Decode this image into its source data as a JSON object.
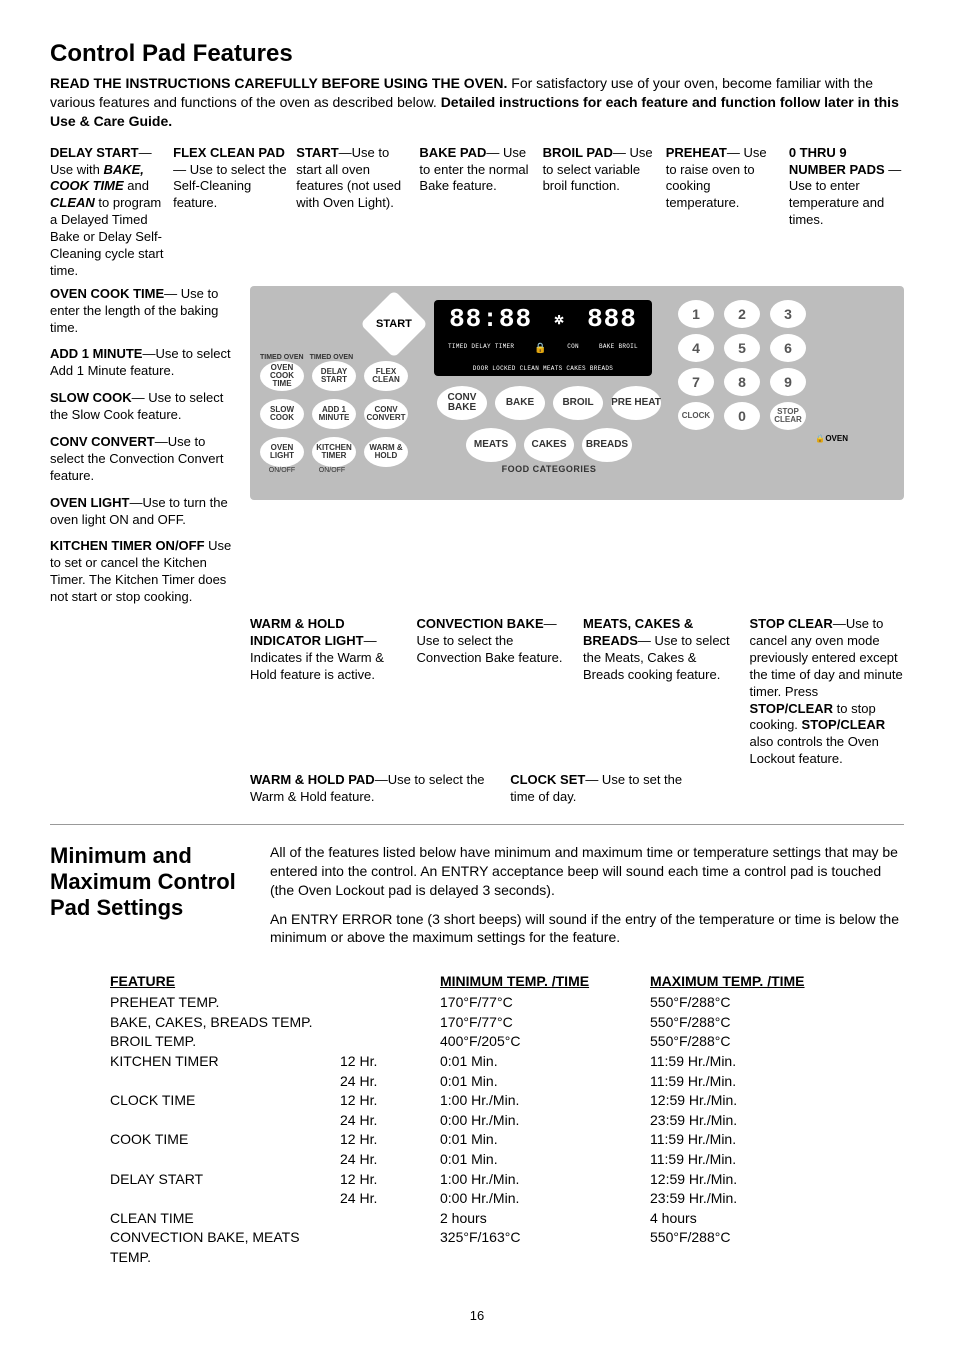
{
  "title": "Control Pad Features",
  "intro": {
    "bold1": "READ THE INSTRUCTIONS CAREFULLY BEFORE USING THE OVEN.",
    "mid": " For satisfactory use of your oven, become familiar with the various features and functions of the oven as described below. ",
    "bold2": "Detailed instructions for each feature and function follow later in this Use & Care Guide."
  },
  "topCallouts": [
    {
      "h": "DELAY START",
      "t": "— Use with BAKE, COOK TIME and CLEAN to program a Delayed Timed Bake or Delay Self-Cleaning cycle start time.",
      "bold2": "BAKE, COOK TIME",
      "bold3": "CLEAN"
    },
    {
      "h": "FLEX CLEAN PAD",
      "t": "— Use to select the Self-Cleaning feature."
    },
    {
      "h": "START",
      "t": "—Use to start all oven features (not used with Oven Light)."
    },
    {
      "h": "BAKE PAD",
      "t": "— Use to enter the normal Bake feature."
    },
    {
      "h": "BROIL PAD",
      "t": "— Use to select variable broil function."
    },
    {
      "h": "PREHEAT",
      "t": "— Use to raise oven to cooking temperature."
    },
    {
      "h": "0 THRU 9 NUMBER PADS",
      "t": " — Use to enter temperature and times."
    }
  ],
  "leftCallouts": [
    {
      "h": "OVEN COOK TIME",
      "t": "— Use to enter the length of the baking time."
    },
    {
      "h": "ADD 1 MINUTE",
      "t": "—Use to select Add 1 Minute feature."
    },
    {
      "h": "SLOW COOK",
      "t": "— Use to select the Slow Cook feature."
    },
    {
      "h": "CONV CONVERT",
      "t": "—Use to select the Convection Convert feature."
    },
    {
      "h": "OVEN LIGHT",
      "t": "—Use to turn the oven light ON and OFF."
    },
    {
      "h": "KITCHEN TIMER ON/OFF",
      "t": " Use  to set or cancel the Kitchen Timer. The Kitchen Timer does not start or stop cooking."
    }
  ],
  "panel": {
    "start": "START",
    "row1": [
      "TIMED OVEN",
      "TIMED OVEN"
    ],
    "row2": [
      "OVEN COOK TIME",
      "DELAY START",
      "FLEX CLEAN"
    ],
    "row3": [
      "SLOW COOK",
      "ADD 1 MINUTE",
      "CONV CONVERT"
    ],
    "row4": [
      "OVEN LIGHT",
      "KITCHEN TIMER",
      "WARM & HOLD"
    ],
    "row4sub": [
      "ON/OFF",
      "ON/OFF",
      ""
    ],
    "lcd": {
      "clock": "88:88",
      "temp": "888",
      "line2a": "TIMED  DELAY  TIMER",
      "line2b": "CON",
      "line2c": "BAKE  BROIL",
      "line3": "DOOR LOCKED  CLEAN    MEATS CAKES BREADS"
    },
    "cookrow": [
      "CONV BAKE",
      "BAKE",
      "BROIL",
      "PRE HEAT"
    ],
    "foodrow": [
      "MEATS",
      "CAKES",
      "BREADS"
    ],
    "foodcat": "FOOD CATEGORIES",
    "keypad": [
      "1",
      "2",
      "3",
      "4",
      "5",
      "6",
      "7",
      "8",
      "9"
    ],
    "keypadBottom": [
      "CLOCK",
      "0",
      "STOP CLEAR"
    ],
    "ovenlock": "OVEN"
  },
  "botCallouts": [
    {
      "h": "WARM & HOLD INDICATOR LIGHT",
      "t": "—Indicates if the Warm & Hold feature is active."
    },
    {
      "h": "CONVECTION BAKE",
      "t": "— Use to select the Convection Bake feature."
    },
    {
      "h": "MEATS, CAKES & BREADS",
      "t": "— Use to select the Meats, Cakes & Breads cooking feature."
    },
    {
      "h": "STOP CLEAR",
      "t": "—Use to cancel any oven mode previously entered except the time of day and minute timer. Press STOP/CLEAR to stop cooking. STOP/CLEAR also controls the Oven Lockout feature.",
      "bold2": "STOP/CLEAR",
      "bold3": "STOP/CLEAR"
    }
  ],
  "warmHoldPad": {
    "h": "WARM & HOLD PAD",
    "t": "—Use to select the Warm & Hold feature."
  },
  "clockSet": {
    "h": "CLOCK SET",
    "t": "— Use to set the time of day."
  },
  "section2": {
    "title": "Minimum and Maximum Control Pad Settings",
    "p1": "All of the features listed below have minimum and maximum time or temperature settings that may be entered into the control. An ENTRY acceptance beep will sound each time a control pad is touched (the Oven Lockout  pad is delayed 3 seconds).",
    "p2": "An ENTRY ERROR tone (3 short beeps) will sound if the entry of the temperature or time is below the minimum or above the maximum settings for the feature."
  },
  "table": {
    "headers": [
      "FEATURE",
      "",
      "MINIMUM TEMP. /TIME",
      "MAXIMUM TEMP. /TIME"
    ],
    "rows": [
      [
        "PREHEAT TEMP.",
        "",
        "170°F/77°C",
        "550°F/288°C"
      ],
      [
        "BAKE, CAKES, BREADS TEMP.",
        "",
        "170°F/77°C",
        "550°F/288°C"
      ],
      [
        "BROIL TEMP.",
        "",
        "400°F/205°C",
        "550°F/288°C"
      ],
      [
        "KITCHEN TIMER",
        "12 Hr.",
        "0:01 Min.",
        "11:59 Hr./Min."
      ],
      [
        "",
        "24 Hr.",
        "0:01 Min.",
        "11:59 Hr./Min."
      ],
      [
        "CLOCK TIME",
        "12 Hr.",
        "1:00 Hr./Min.",
        "12:59 Hr./Min."
      ],
      [
        "",
        "24 Hr.",
        "0:00 Hr./Min.",
        "23:59 Hr./Min."
      ],
      [
        "COOK TIME",
        "12 Hr.",
        "0:01 Min.",
        "11:59 Hr./Min."
      ],
      [
        "",
        "24 Hr.",
        "0:01 Min.",
        "11:59 Hr./Min."
      ],
      [
        "DELAY START",
        "12 Hr.",
        "1:00 Hr./Min.",
        "12:59 Hr./Min."
      ],
      [
        "",
        "24 Hr.",
        "0:00 Hr./Min.",
        "23:59 Hr./Min."
      ],
      [
        "CLEAN TIME",
        "",
        "2 hours",
        "4 hours"
      ],
      [
        "CONVECTION BAKE, MEATS TEMP.",
        "",
        "325°F/163°C",
        "550°F/288°C"
      ]
    ]
  },
  "pageNum": "16"
}
